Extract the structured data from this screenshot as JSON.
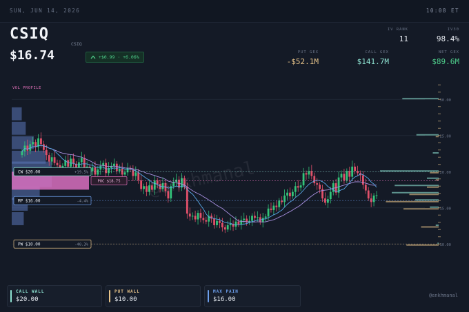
{
  "header": {
    "date": "SUN, JUN 14, 2026",
    "time": "10:08 ET",
    "ticker": "CSIQ",
    "ticker_sub": "CSIQ",
    "price": "$16.74",
    "change": "+$0.99 · +6.06%",
    "stats_top": [
      {
        "label": "IV RANK",
        "value": "11"
      },
      {
        "label": "IV30",
        "value": "98.4%"
      }
    ],
    "stats_bottom": [
      {
        "label": "PUT GEX",
        "value": "-$52.1M"
      },
      {
        "label": "CALL GEX",
        "value": "$141.7M"
      },
      {
        "label": "NET GEX",
        "value": "$89.6M"
      }
    ]
  },
  "colors": {
    "up": "#33c47a",
    "down": "#e0506a",
    "sma_short": "#5aa8e8",
    "sma_long": "#a890e0",
    "call_wall": "#8ee3d2",
    "put_wall": "#e8c48a",
    "max_pain": "#6ea0ee",
    "poc": "#e070b8"
  },
  "chart_data": {
    "type": "candlestick",
    "ylim": [
      8.5,
      32.5
    ],
    "y_ticks": [
      "30.00",
      "25.00",
      "20.00",
      "15.00",
      "10.00"
    ],
    "y_tick_values": [
      30,
      25,
      20,
      15,
      10
    ],
    "volume_profile_label": "VOL PROFILE",
    "watermark": "@enkhmanal",
    "closes": [
      22.8,
      23.6,
      22.9,
      23.8,
      24.1,
      23.4,
      24.6,
      23.8,
      23.0,
      22.3,
      21.4,
      22.0,
      21.2,
      20.9,
      20.3,
      20.8,
      21.6,
      20.7,
      21.8,
      21.1,
      20.2,
      21.3,
      21.9,
      20.4,
      20.7,
      20.1,
      20.6,
      19.6,
      20.3,
      20.8,
      21.2,
      19.8,
      20.5,
      20.8,
      21.1,
      20.1,
      20.4,
      19.6,
      19.9,
      20.5,
      20.3,
      19.4,
      19.9,
      18.8,
      17.6,
      18.0,
      17.2,
      18.1,
      17.5,
      18.8,
      18.3,
      17.6,
      18.4,
      17.3,
      16.3,
      18.0,
      18.6,
      18.9,
      17.8,
      19.1,
      17.9,
      14.2,
      13.8,
      13.9,
      13.4,
      14.3,
      13.6,
      13.3,
      13.1,
      13.9,
      13.5,
      12.6,
      13.2,
      12.9,
      12.3,
      12.0,
      12.6,
      12.8,
      12.4,
      13.1,
      12.7,
      13.3,
      13.5,
      13.0,
      13.2,
      13.9,
      13.6,
      13.7,
      13.0,
      13.6,
      13.8,
      14.9,
      14.7,
      15.3,
      15.1,
      16.0,
      15.8,
      16.7,
      17.1,
      16.6,
      17.2,
      18.0,
      17.8,
      18.1,
      19.8,
      19.6,
      20.1,
      19.4,
      18.4,
      18.2,
      17.6,
      16.3,
      15.7,
      16.2,
      17.2,
      18.4,
      17.1,
      19.2,
      19.7,
      18.8,
      20.1,
      19.3,
      20.7,
      20.1,
      19.8,
      19.5,
      18.2,
      17.4,
      16.3,
      15.8,
      16.7,
      16.74
    ],
    "key_levels": [
      {
        "name": "CW $20.00",
        "pct": "+19.5%",
        "value": 20.0
      },
      {
        "name": "MP $16.00",
        "pct": "-4.4%",
        "value": 16.0
      },
      {
        "name": "PW $10.00",
        "pct": "-40.3%",
        "value": 10.0
      }
    ],
    "poc": {
      "label": "POC $18.75",
      "value": 18.75
    },
    "volume_profile": [
      {
        "price": 28,
        "weight": 0.25
      },
      {
        "price": 26,
        "weight": 0.35
      },
      {
        "price": 24,
        "weight": 0.55
      },
      {
        "price": 22,
        "weight": 0.85
      },
      {
        "price": 20.5,
        "weight": 1.0
      },
      {
        "price": 18.75,
        "weight": 1.0
      },
      {
        "price": 17,
        "weight": 0.7
      },
      {
        "price": 15.5,
        "weight": 0.4
      },
      {
        "price": 13.5,
        "weight": 0.3
      }
    ],
    "strike_gex": [
      {
        "strike": 30,
        "call": 0.62,
        "put": 0.0
      },
      {
        "strike": 25,
        "call": 0.38,
        "put": 0.05
      },
      {
        "strike": 22.5,
        "call": 0.1,
        "put": 0.0
      },
      {
        "strike": 20,
        "call": 1.0,
        "put": 0.15
      },
      {
        "strike": 19,
        "call": 0.2,
        "put": 0.05
      },
      {
        "strike": 18,
        "call": 0.75,
        "put": 0.2
      },
      {
        "strike": 17,
        "call": 0.8,
        "put": 0.5
      },
      {
        "strike": 16,
        "call": 0.4,
        "put": 0.9
      },
      {
        "strike": 15,
        "call": 0.15,
        "put": 0.6
      },
      {
        "strike": 12.5,
        "call": 0.05,
        "put": 0.3
      },
      {
        "strike": 10,
        "call": 0.02,
        "put": 0.55
      }
    ]
  },
  "footer": {
    "cards": [
      {
        "label": "CALL WALL",
        "value": "$20.00"
      },
      {
        "label": "PUT WALL",
        "value": "$10.00"
      },
      {
        "label": "MAX PAIN",
        "value": "$16.00"
      }
    ],
    "credit": "@enkhmanal"
  }
}
